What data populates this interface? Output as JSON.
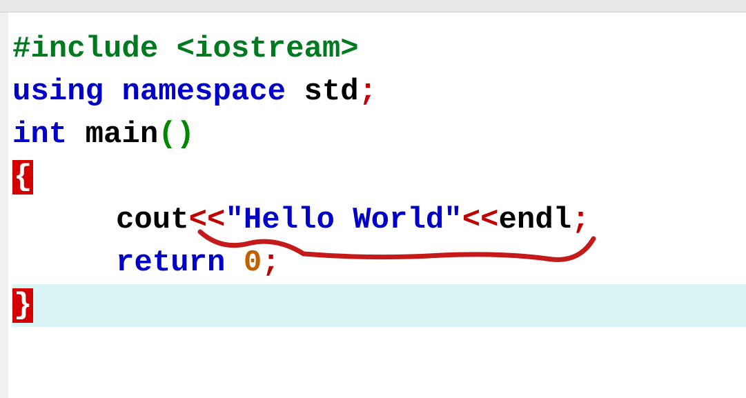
{
  "code": {
    "line1": {
      "include": "#include ",
      "header": "<iostream>"
    },
    "line2": {
      "using": "using ",
      "namespace": "namespace ",
      "std": "std",
      "semi": ";"
    },
    "line3": {
      "int": "int ",
      "main": "main",
      "lparen": "(",
      "rparen": ")"
    },
    "line4": {
      "brace": "{"
    },
    "line5": {
      "cout": "cout",
      "op1": "<<",
      "string": "\"Hello World\"",
      "op2": "<<",
      "endl": "endl",
      "semi": ";"
    },
    "line6": {
      "return": "return ",
      "zero": "0",
      "semi": ";"
    },
    "line7": {
      "brace": "}"
    }
  }
}
